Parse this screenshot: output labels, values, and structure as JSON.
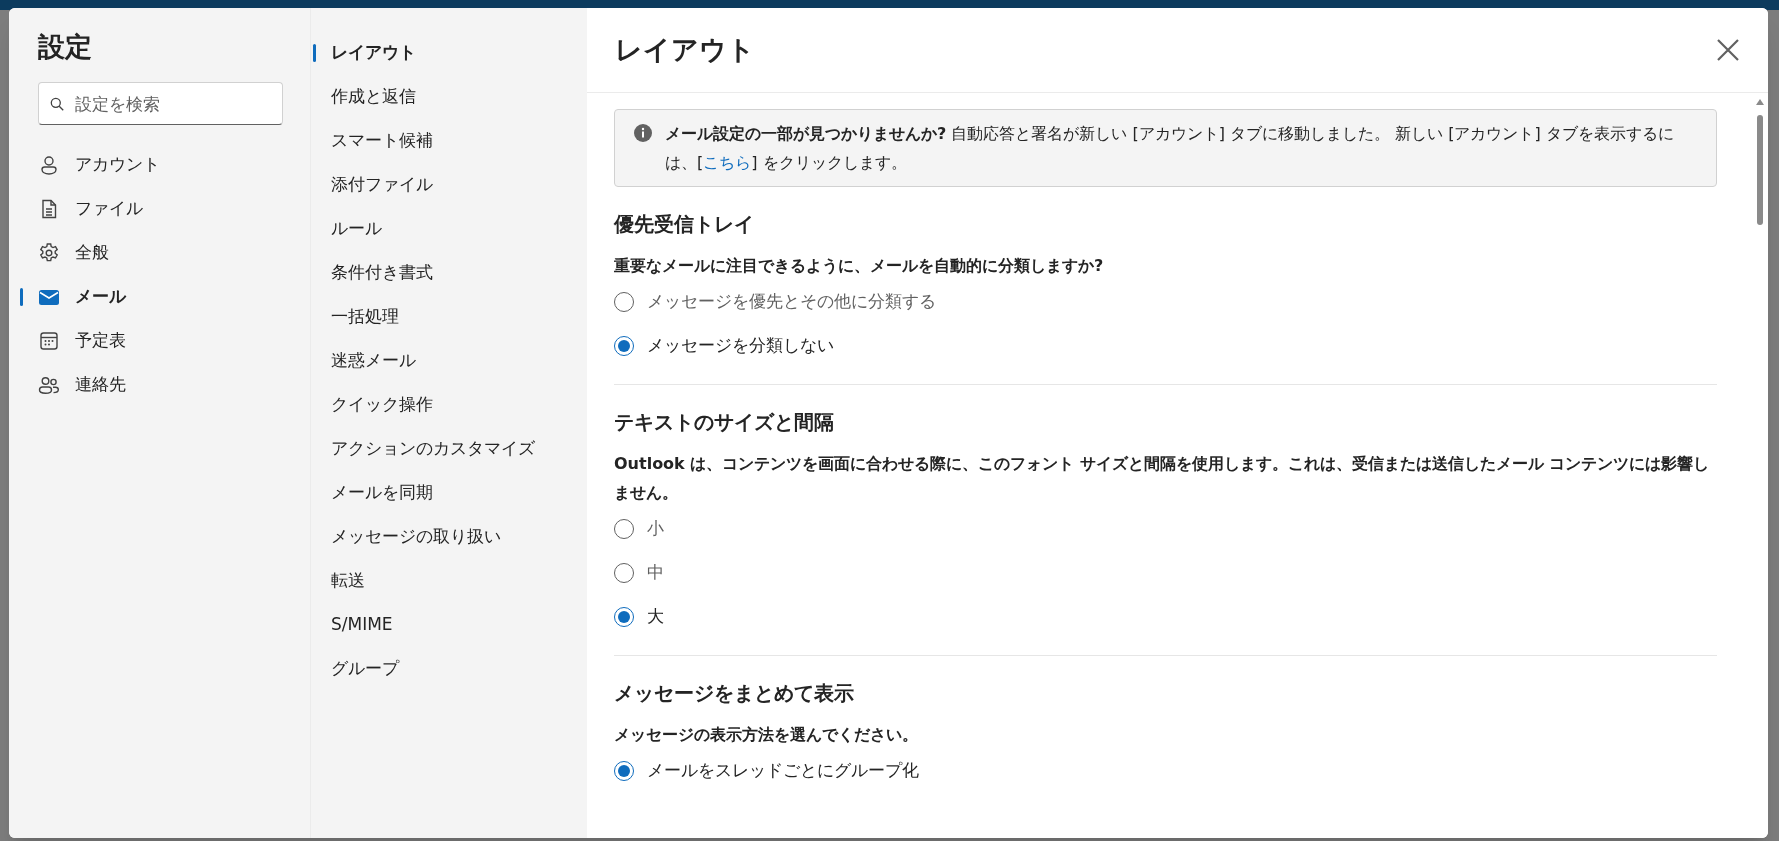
{
  "settings": {
    "title": "設定",
    "search": {
      "placeholder": "設定を検索"
    },
    "categories": [
      {
        "label": "アカウント",
        "selected": false
      },
      {
        "label": "ファイル",
        "selected": false
      },
      {
        "label": "全般",
        "selected": false
      },
      {
        "label": "メール",
        "selected": true
      },
      {
        "label": "予定表",
        "selected": false
      },
      {
        "label": "連絡先",
        "selected": false
      }
    ]
  },
  "subnav": [
    {
      "label": "レイアウト",
      "selected": true
    },
    {
      "label": "作成と返信",
      "selected": false
    },
    {
      "label": "スマート候補",
      "selected": false
    },
    {
      "label": "添付ファイル",
      "selected": false
    },
    {
      "label": "ルール",
      "selected": false
    },
    {
      "label": "条件付き書式",
      "selected": false
    },
    {
      "label": "一括処理",
      "selected": false
    },
    {
      "label": "迷惑メール",
      "selected": false
    },
    {
      "label": "クイック操作",
      "selected": false
    },
    {
      "label": "アクションのカスタマイズ",
      "selected": false
    },
    {
      "label": "メールを同期",
      "selected": false
    },
    {
      "label": "メッセージの取り扱い",
      "selected": false
    },
    {
      "label": "転送",
      "selected": false
    },
    {
      "label": "S/MIME",
      "selected": false
    },
    {
      "label": "グループ",
      "selected": false
    }
  ],
  "page": {
    "title": "レイアウト",
    "notice": {
      "text": "**メール設定の一部が見つかりませんか?** 自動応答と署名が新しい [アカウント] タブに移動しました。 新しい [アカウント] タブを表示するには、[",
      "link": "こちら",
      "text_after": "] をクリックします。"
    },
    "sections": [
      {
        "title": "優先受信トレイ",
        "question": "重要なメールに注目できるように、メールを自動的に分類しますか?",
        "options": [
          {
            "label": "メッセージを優先とその他に分類する",
            "selected": false
          },
          {
            "label": "メッセージを分類しない",
            "selected": true
          }
        ]
      },
      {
        "title": "テキストのサイズと間隔",
        "question": "Outlook は、コンテンツを画面に合わせる際に、このフォント サイズと間隔を使用します。これは、受信または送信したメール コンテンツには影響しません。",
        "options": [
          {
            "label": "小",
            "selected": false
          },
          {
            "label": "中",
            "selected": false
          },
          {
            "label": "大",
            "selected": true
          }
        ]
      },
      {
        "title": "メッセージをまとめて表示",
        "question": "メッセージの表示方法を選んでください。",
        "options": [
          {
            "label": "メールをスレッドごとにグループ化",
            "selected": true
          }
        ]
      }
    ]
  }
}
